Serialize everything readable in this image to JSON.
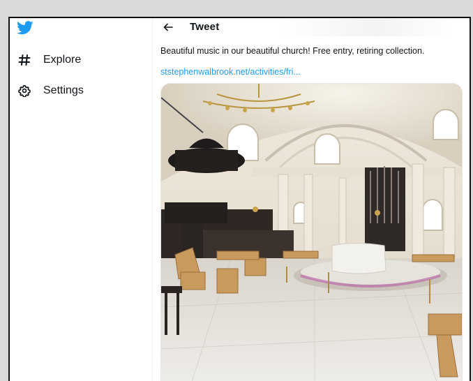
{
  "sidebar": {
    "logo_icon": "twitter-bird-icon",
    "items": [
      {
        "label": "Explore",
        "icon": "hashtag-icon"
      },
      {
        "label": "Settings",
        "icon": "gear-icon"
      }
    ]
  },
  "header": {
    "back_icon": "arrow-left-icon",
    "title": "Tweet"
  },
  "tweet": {
    "text": "Beautiful music in our beautiful church! Free entry, retiring collection.",
    "link": "ststephenwalbrook.net/activities/fri...",
    "media_subject": "church-interior-photo"
  },
  "colors": {
    "brand": "#1d9bf0",
    "text": "#0f1419"
  }
}
